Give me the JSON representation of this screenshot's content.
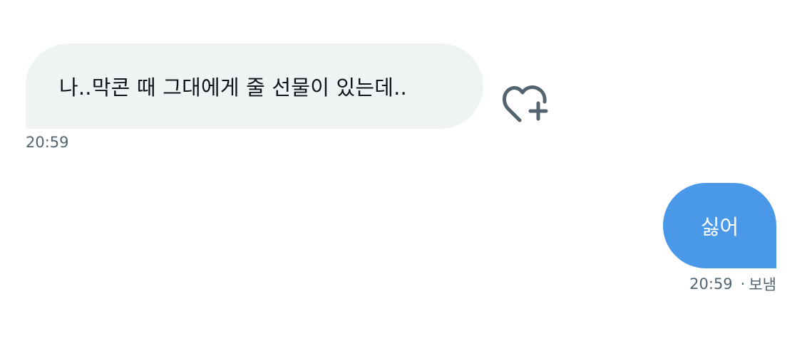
{
  "conversation": {
    "messages": [
      {
        "direction": "received",
        "text": "나..막콘 때 그대에게 줄 선물이 있는데..",
        "time": "20:59",
        "reaction_icon": "heart-plus-icon"
      },
      {
        "direction": "sent",
        "text": "싫어",
        "time": "20:59",
        "separator": "·",
        "status": "보냄"
      }
    ]
  },
  "colors": {
    "received_bubble": "#eff3f4",
    "sent_bubble": "#4a99e9",
    "meta_text": "#536471",
    "icon": "#536471"
  }
}
